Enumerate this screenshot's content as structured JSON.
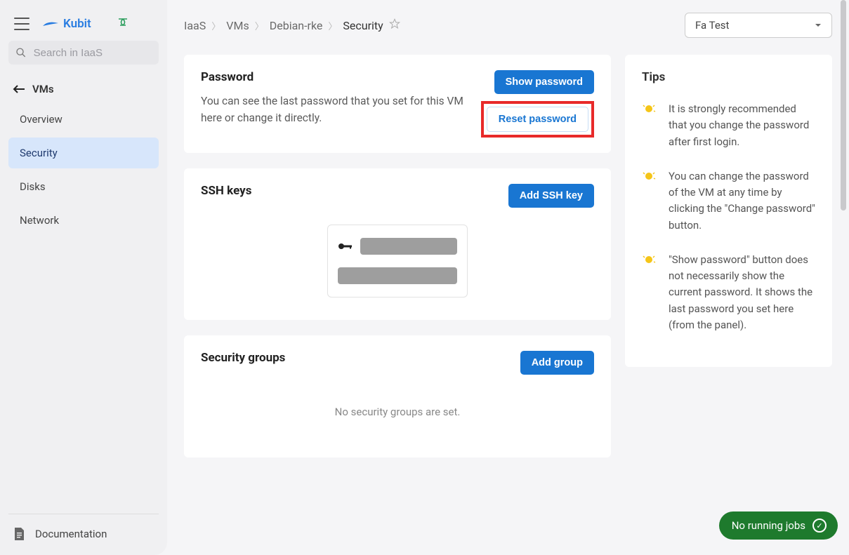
{
  "brand": {
    "name": "Kubit"
  },
  "search": {
    "placeholder": "Search in IaaS"
  },
  "back": {
    "label": "VMs"
  },
  "nav": {
    "items": [
      {
        "label": "Overview"
      },
      {
        "label": "Security"
      },
      {
        "label": "Disks"
      },
      {
        "label": "Network"
      }
    ]
  },
  "documentation_label": "Documentation",
  "breadcrumb": {
    "items": [
      {
        "label": "IaaS"
      },
      {
        "label": "VMs"
      },
      {
        "label": "Debian-rke"
      },
      {
        "label": "Security"
      }
    ]
  },
  "account": {
    "selected": "Fa Test"
  },
  "password_card": {
    "title": "Password",
    "description": "You can see the last password that you set for this VM here or change it directly.",
    "show_btn": "Show password",
    "reset_btn": "Reset password"
  },
  "ssh_card": {
    "title": "SSH keys",
    "add_btn": "Add SSH key"
  },
  "sg_card": {
    "title": "Security groups",
    "add_btn": "Add group",
    "empty": "No security groups are set."
  },
  "tips": {
    "title": "Tips",
    "items": [
      "It is strongly recommended that you change the password after first login.",
      "You can change the password of the VM at any time by clicking the \"Change password\" button.",
      "\"Show password\" button does not necessarily show the current password. It shows the last password you set here (from the panel)."
    ]
  },
  "jobs": {
    "label": "No running jobs"
  }
}
